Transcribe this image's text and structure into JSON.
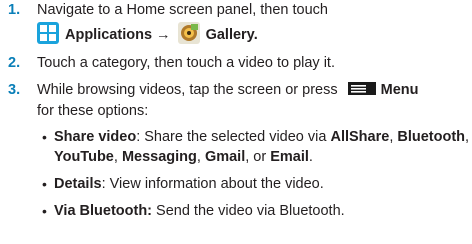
{
  "steps": [
    {
      "number": "1.",
      "line1": "Navigate to a Home screen panel, then touch",
      "applications_label": "Applications",
      "arrow": "→",
      "gallery_label": "Gallery",
      "period": "."
    },
    {
      "number": "2.",
      "text": "Touch a category, then touch a video to play it."
    },
    {
      "number": "3.",
      "line1": "While browsing videos, tap the screen or press",
      "menu_label": "Menu",
      "line2": "for these options:"
    }
  ],
  "options": [
    {
      "bullet": "•",
      "title": "Share video",
      "sep": ": Share the selected video via ",
      "allshare": "AllShare",
      "bluetooth": "Bluetooth",
      "youtube": "YouTube",
      "messaging": "Messaging",
      "gmail": "Gmail",
      "email": "Email",
      "comma": ", ",
      "or": ", or ",
      "end": "."
    },
    {
      "bullet": "•",
      "title": "Details",
      "desc": ": View information about the video."
    },
    {
      "bullet": "•",
      "title": "Via Bluetooth:",
      "desc": " Send the video via Bluetooth."
    }
  ],
  "icons": [
    "applications-icon",
    "gallery-icon",
    "menu-key-icon"
  ],
  "colors": {
    "step_number": "#0a7fb8",
    "text": "#231f20"
  }
}
